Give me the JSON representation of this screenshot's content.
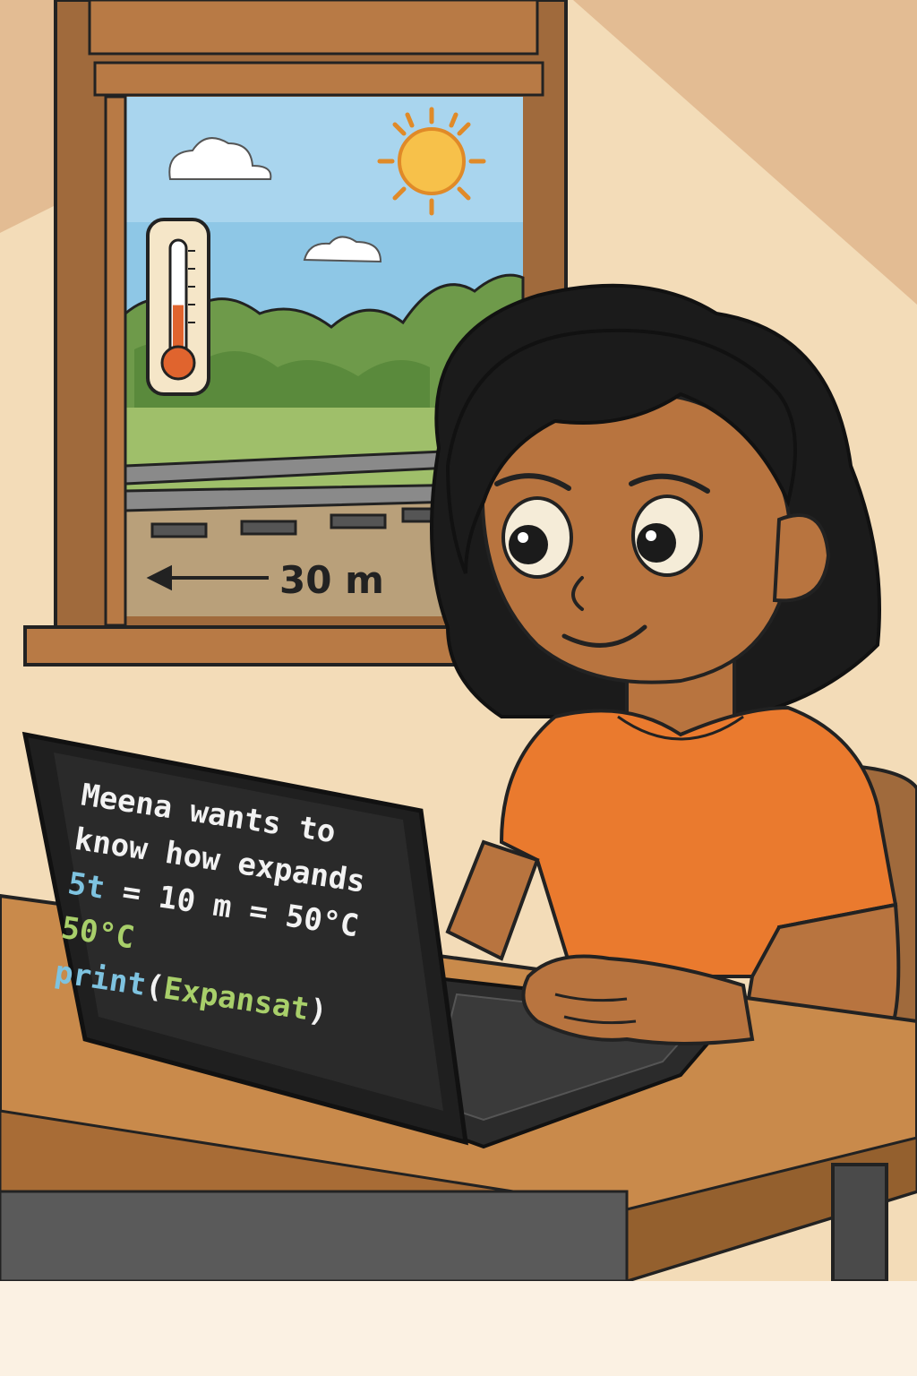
{
  "scene": {
    "distance_label": "30 m",
    "thermometer_level": 0.45
  },
  "laptop_screen": {
    "lines": [
      "Meena wants to",
      "know how expands",
      "5t = 10 m = 50°C",
      "50°C",
      "print(Expansat)"
    ],
    "line3_parts": [
      "5t",
      " = 10 m = 50°C"
    ],
    "line5_parts": [
      "print",
      "(",
      "Expansat",
      ")"
    ]
  },
  "colors": {
    "wall": "#f3dcb8",
    "wall_shadow": "#deb48a",
    "sky": "#8ec7e6",
    "sun": "#f7c14a",
    "window_frame": "#a06a3c",
    "desk": "#c98a4b",
    "shirt": "#ea7a2e",
    "skin": "#b8743f",
    "hair": "#1b1b1b",
    "screen": "#2a2a2a",
    "code_white": "#f2f2f2",
    "code_blue": "#7ec3e0",
    "code_green": "#a8cf6a",
    "thermometer_red": "#e0642e"
  }
}
